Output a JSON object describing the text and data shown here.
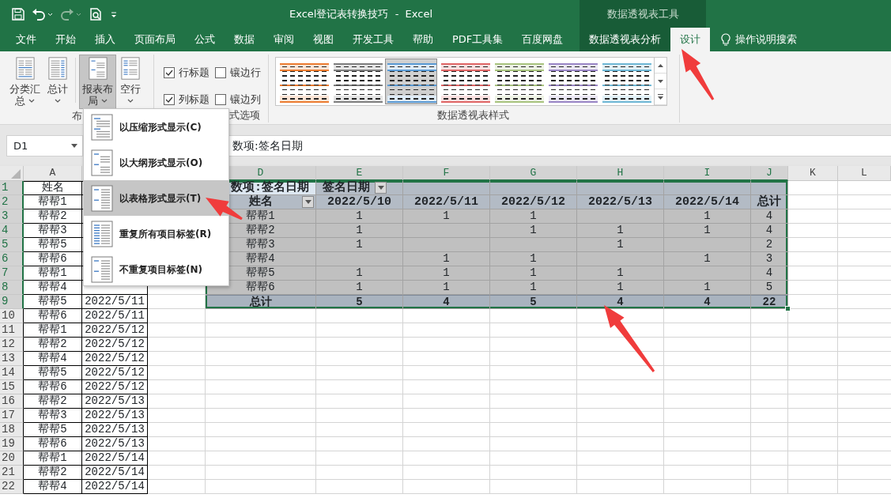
{
  "title_bar": {
    "quick_access": [
      {
        "kind": "save",
        "disabled": false
      },
      {
        "kind": "undo",
        "disabled": false
      },
      {
        "kind": "redo",
        "disabled": true
      },
      {
        "kind": "print_preview",
        "disabled": false
      },
      {
        "kind": "customize",
        "disabled": false
      }
    ],
    "title": "Excel登记表转换技巧  -  Excel",
    "context_title": "数据透视表工具"
  },
  "tabs": [
    {
      "label": "文件",
      "selected": false,
      "contextual": false
    },
    {
      "label": "开始",
      "selected": false,
      "contextual": false
    },
    {
      "label": "插入",
      "selected": false,
      "contextual": false
    },
    {
      "label": "页面布局",
      "selected": false,
      "contextual": false
    },
    {
      "label": "公式",
      "selected": false,
      "contextual": false
    },
    {
      "label": "数据",
      "selected": false,
      "contextual": false
    },
    {
      "label": "审阅",
      "selected": false,
      "contextual": false
    },
    {
      "label": "视图",
      "selected": false,
      "contextual": false
    },
    {
      "label": "开发工具",
      "selected": false,
      "contextual": false
    },
    {
      "label": "帮助",
      "selected": false,
      "contextual": false
    },
    {
      "label": "PDF工具集",
      "selected": false,
      "contextual": false
    },
    {
      "label": "百度网盘",
      "selected": false,
      "contextual": false
    },
    {
      "label": "数据透视表分析",
      "selected": false,
      "contextual": true
    },
    {
      "label": "设计",
      "selected": true,
      "contextual": true
    }
  ],
  "tell_me": {
    "label": "操作说明搜索"
  },
  "ribbon": {
    "layout_group": {
      "label": "布",
      "buttons": [
        {
          "kind": "subtotals",
          "lines": [
            "分类汇",
            "总"
          ],
          "pressed": false
        },
        {
          "kind": "grand_totals",
          "lines": [
            "总计"
          ],
          "pressed": false
        },
        {
          "kind": "report_layout",
          "lines": [
            "报表布",
            "局"
          ],
          "pressed": true
        },
        {
          "kind": "blank_rows",
          "lines": [
            "空行"
          ],
          "pressed": false
        }
      ]
    },
    "style_options_group": {
      "label": "式选项",
      "checkboxes": [
        {
          "label": "行标题",
          "checked": true
        },
        {
          "label": "镶边行",
          "checked": false
        },
        {
          "label": "列标题",
          "checked": true
        },
        {
          "label": "镶边列",
          "checked": false
        }
      ]
    },
    "styles_group": {
      "label": "数据透视表样式",
      "styles": [
        {
          "color": "#ed7d31",
          "selected": false
        },
        {
          "color": "#7f7f7f",
          "selected": false
        },
        {
          "color": "#5b9bd5",
          "selected": true
        },
        {
          "color": "#e06666",
          "selected": false
        },
        {
          "color": "#a9c47f",
          "selected": false
        },
        {
          "color": "#9a86c6",
          "selected": false
        },
        {
          "color": "#6fb8d6",
          "selected": false
        }
      ]
    }
  },
  "layout_menu": {
    "items": [
      {
        "kind": "compact",
        "label": "以压缩形式显示(C)",
        "selected": false
      },
      {
        "kind": "outline",
        "label": "以大纲形式显示(O)",
        "selected": false
      },
      {
        "kind": "tabular",
        "label": "以表格形式显示(T)",
        "selected": true
      },
      {
        "kind": "repeat",
        "label": "重复所有项目标签(R)",
        "selected": false
      },
      {
        "kind": "no_repeat",
        "label": "不重复项目标签(N)",
        "selected": false
      }
    ]
  },
  "formula_bar": {
    "name_box": "D1",
    "formula": "数项:签名日期"
  },
  "sheet": {
    "columns": [
      {
        "label": "A",
        "highlighted": false
      },
      {
        "label": "D",
        "highlighted": true
      },
      {
        "label": "E",
        "highlighted": true
      },
      {
        "label": "F",
        "highlighted": true
      },
      {
        "label": "G",
        "highlighted": true
      },
      {
        "label": "H",
        "highlighted": true
      },
      {
        "label": "I",
        "highlighted": true
      },
      {
        "label": "J",
        "highlighted": true
      },
      {
        "label": "K",
        "highlighted": false
      },
      {
        "label": "L",
        "highlighted": false
      }
    ],
    "rows": [
      {
        "number": "1",
        "highlighted": true,
        "name": "姓名"
      },
      {
        "number": "2",
        "highlighted": true,
        "name": "帮帮1"
      },
      {
        "number": "3",
        "highlighted": true,
        "name": "帮帮2"
      },
      {
        "number": "4",
        "highlighted": true,
        "name": "帮帮3"
      },
      {
        "number": "5",
        "highlighted": true,
        "name": "帮帮5"
      },
      {
        "number": "6",
        "highlighted": true,
        "name": "帮帮6"
      },
      {
        "number": "7",
        "highlighted": true,
        "name": "帮帮1"
      },
      {
        "number": "8",
        "highlighted": true,
        "name": "帮帮4"
      },
      {
        "number": "9",
        "highlighted": true,
        "name": "帮帮5",
        "date": "2022/5/11"
      },
      {
        "number": "10",
        "highlighted": false,
        "name": "帮帮6",
        "date": "2022/5/11"
      },
      {
        "number": "11",
        "highlighted": false,
        "name": "帮帮1",
        "date": "2022/5/12"
      },
      {
        "number": "12",
        "highlighted": false,
        "name": "帮帮2",
        "date": "2022/5/12"
      },
      {
        "number": "13",
        "highlighted": false,
        "name": "帮帮4",
        "date": "2022/5/12"
      },
      {
        "number": "14",
        "highlighted": false,
        "name": "帮帮5",
        "date": "2022/5/12"
      },
      {
        "number": "15",
        "highlighted": false,
        "name": "帮帮6",
        "date": "2022/5/12"
      },
      {
        "number": "16",
        "highlighted": false,
        "name": "帮帮2",
        "date": "2022/5/13"
      },
      {
        "number": "17",
        "highlighted": false,
        "name": "帮帮3",
        "date": "2022/5/13"
      },
      {
        "number": "18",
        "highlighted": false,
        "name": "帮帮5",
        "date": "2022/5/13"
      },
      {
        "number": "19",
        "highlighted": false,
        "name": "帮帮6",
        "date": "2022/5/13"
      },
      {
        "number": "20",
        "highlighted": false,
        "name": "帮帮1",
        "date": "2022/5/14"
      },
      {
        "number": "21",
        "highlighted": false,
        "name": "帮帮2",
        "date": "2022/5/14"
      },
      {
        "number": "22",
        "highlighted": false,
        "name": "帮帮4",
        "date": "2022/5/14"
      }
    ]
  },
  "pivot": {
    "value_field": "数项:签名日期",
    "column_field": "签名日期",
    "row_field": "姓名",
    "dates": [
      "2022/5/10",
      "2022/5/11",
      "2022/5/12",
      "2022/5/13",
      "2022/5/14"
    ],
    "grand_total_label": "总计",
    "rows": [
      {
        "name": "帮帮1",
        "E": "1",
        "F": "1",
        "G": "1",
        "I": "1",
        "total": "4"
      },
      {
        "name": "帮帮2",
        "E": "1",
        "G": "1",
        "H": "1",
        "I": "1",
        "total": "4"
      },
      {
        "name": "帮帮3",
        "E": "1",
        "H": "1",
        "total": "2"
      },
      {
        "name": "帮帮4",
        "F": "1",
        "G": "1",
        "I": "1",
        "total": "3"
      },
      {
        "name": "帮帮5",
        "E": "1",
        "F": "1",
        "G": "1",
        "H": "1",
        "total": "4"
      },
      {
        "name": "帮帮6",
        "E": "1",
        "F": "1",
        "G": "1",
        "H": "1",
        "I": "1",
        "total": "5"
      }
    ],
    "totals": {
      "label": "总计",
      "E": "5",
      "F": "4",
      "G": "5",
      "H": "4",
      "I": "4",
      "total": "22"
    }
  }
}
